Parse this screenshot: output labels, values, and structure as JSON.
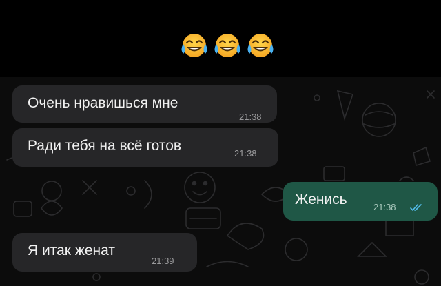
{
  "header": {
    "emojis": [
      "face-with-tears-of-joy",
      "face-with-tears-of-joy",
      "face-with-tears-of-joy"
    ]
  },
  "chat": {
    "messages": [
      {
        "direction": "incoming",
        "text": "Очень нравишься мне",
        "time": "21:38"
      },
      {
        "direction": "incoming",
        "text": "Ради тебя на всё готов",
        "time": "21:38"
      },
      {
        "direction": "outgoing",
        "text": "Женись",
        "time": "21:38",
        "status": "read"
      },
      {
        "direction": "incoming",
        "text": "Я итак женат",
        "time": "21:39"
      }
    ]
  },
  "colors": {
    "background": "#000000",
    "chat_background": "#0c0c0c",
    "incoming_bubble": "#262628",
    "outgoing_bubble": "#1f5746",
    "read_check": "#53bdeb"
  }
}
